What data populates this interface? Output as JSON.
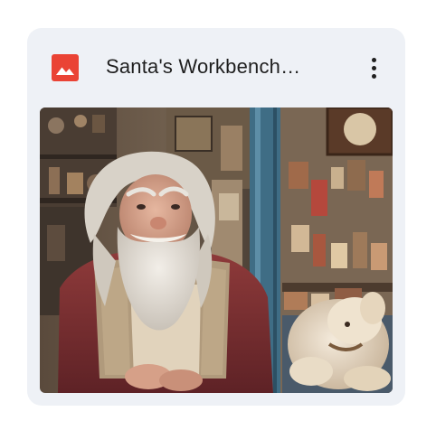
{
  "card": {
    "title": "Santa's Workbench…",
    "file_type_icon": "image-file-icon",
    "menu_icon": "more-vert-icon",
    "thumbnail_icon": "photo-thumbnail"
  },
  "colors": {
    "card_background": "#eef1f6",
    "image_icon_red": "#ea4335",
    "title_text": "#1f1f1f"
  }
}
